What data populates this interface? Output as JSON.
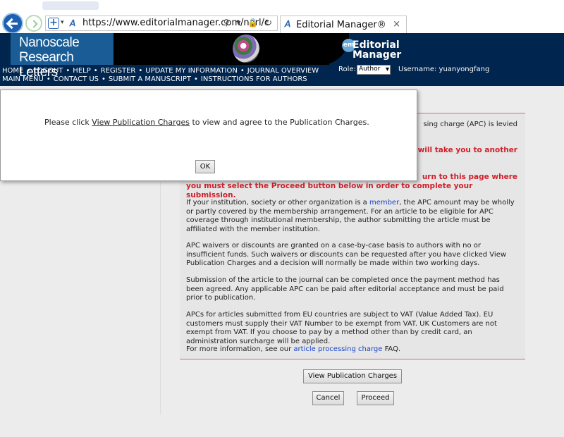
{
  "browser": {
    "url": "https://www.editorialmanager.com/narl/c",
    "tab_title": "Editorial Manager®",
    "tab_close": "×",
    "addr_icons": "⚲ ▾ 🔒 ↻"
  },
  "header": {
    "journal_line1": "Nanoscale",
    "journal_line2": "Research Letters",
    "em_badge": "em",
    "em_title_line1": "Editorial",
    "em_title_line2": "Manager",
    "role_label": "Role:",
    "role_value": "Author",
    "username": "Username: yuanyongfang"
  },
  "menu": {
    "row1": [
      "HOME",
      "LOGOUT",
      "HELP",
      "REGISTER",
      "UPDATE MY INFORMATION",
      "JOURNAL OVERVIEW"
    ],
    "row2": [
      "MAIN MENU",
      "CONTACT US",
      "SUBMIT A MANUSCRIPT",
      "INSTRUCTIONS FOR AUTHORS"
    ]
  },
  "panel": {
    "frag1": "sing charge (APC) is levied",
    "frag2": "will take you to another",
    "frag3": "urn to this page where",
    "red_line": "you must select the Proceed button below in order to complete your submission.",
    "para1_a": "If your institution, society or other organization is a ",
    "para1_link": "member",
    "para1_b": ", the APC amount may be wholly or partly covered by the membership arrangement. For an article to be eligible for APC coverage through institutional membership, the author submitting the article must be affiliated with the member institution.",
    "para2": "APC waivers or discounts are granted on a case-by-case basis to authors with no or insufficient funds. Such waivers or discounts can be requested after you have clicked View Publication Charges and a decision will normally be made within two working days.",
    "para3": "Submission of the article to the journal can be completed once the payment method has been agreed. Any applicable APC can be paid after editorial acceptance and must be paid prior to publication.",
    "para4": "APCs for articles submitted from EU countries are subject to VAT (Value Added Tax). EU customers must supply their VAT Number to be exempt from VAT. UK Customers are not exempt from VAT. If you choose to pay by a method other than by credit card, an administration surcharge will be applied.",
    "para5_a": "For more information, see our ",
    "para5_link": "article processing charge",
    "para5_b": " FAQ."
  },
  "buttons": {
    "view_charges": "View Publication Charges",
    "cancel": "Cancel",
    "proceed": "Proceed"
  },
  "modal": {
    "msg_a": "Please click ",
    "msg_link": "View Publication Charges",
    "msg_b": " to view and agree to the Publication Charges.",
    "ok": "OK"
  }
}
